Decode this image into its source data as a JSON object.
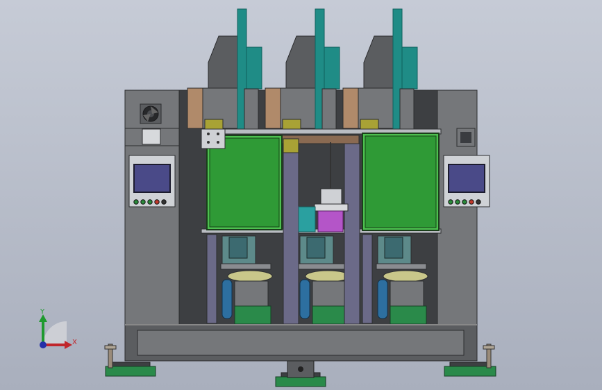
{
  "viewport": {
    "background_top": "#c6cbd6",
    "background_bottom": "#a9afbd"
  },
  "palette": {
    "frame": "#5b5d60",
    "frame_dark": "#3d3f42",
    "frame_light": "#75777a",
    "teal": "#1f8c86",
    "teal_dark": "#0f5f5c",
    "green_panel": "#2f9a36",
    "green_panel_light": "#4cc04f",
    "green_base": "#2a8a4a",
    "copper": "#8a6a52",
    "copper_light": "#b08a6a",
    "olive": "#a8a235",
    "purple": "#b455c8",
    "slate": "#6b6a88",
    "blue_roller": "#2d6fa0",
    "screen": "#4a4a88",
    "bracket": "#8a8c90"
  },
  "hmi_panels": [
    {
      "side": "left",
      "buttons": [
        "#2a8a3a",
        "#2a8a3a",
        "#2a8a3a",
        "#c0392b",
        "#333333"
      ]
    },
    {
      "side": "right",
      "buttons": [
        "#2a8a3a",
        "#2a8a3a",
        "#2a8a3a",
        "#c0392b",
        "#333333"
      ]
    }
  ],
  "stations": 3,
  "triad": {
    "x_label": "X",
    "y_label": "Y",
    "x_color": "#c0262b",
    "y_color": "#1e9a2e",
    "origin_color": "#2430a8"
  }
}
